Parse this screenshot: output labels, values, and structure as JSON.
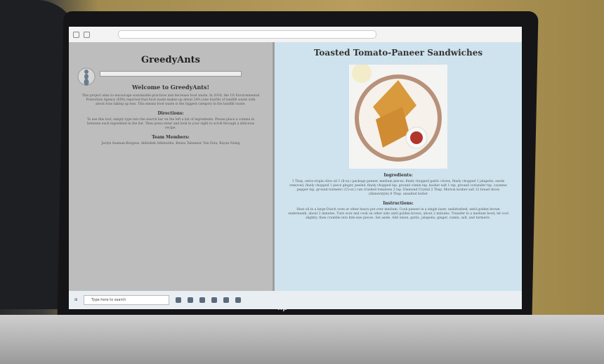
{
  "site": {
    "brand": "GreedyAnts",
    "welcome_heading": "Welcome to GreedyAnts!",
    "intro_text": "This project aims to encourage sustainable practices and decrease food waste. In 2018, the US Environmental Protection Agency (EPA) reported that food waste makes up about 24% (one fourth) of landfill waste with about tons taking up less. This means food waste is the biggest category in the landfill waste.",
    "directions_heading": "Directions:",
    "directions_text": "To use this tool, simply type into the search bar on the left a list of ingredients. Please place a comma in between each ingredient in the list. Then press enter and look to your right to scroll through a delicious recipe.",
    "team_heading": "Team Members:",
    "team_text": "Jaclyn Seaman-Burgess, Abhishek Athimuthu, Bensu Tabaneer, Yan Fatu, Rayan Naing"
  },
  "recipe": {
    "title": "Toasted Tomato-Paneer Sandwiches",
    "ingredients_heading": "Ingredients:",
    "ingredients_text": "1 Tbsp. extra-virgin olive oil 1 (8-oz.) package paneer, medium pieces, finely chopped garlic cloves, finely chopped 1 jalapeño, seeds removed, finely chopped 1 piece ginger, peeled, finely chopped tsp. ground cumin tsp. kosher salt 1 tsp. ground coriander tsp. cayenne pepper tsp. ground turmeric (15-oz.) can crushed tomatoes 2 tsp. Diamond Crystal 2 Tbsp. Morton kosher salt 12 bread slices (dinnerstyle) 6 Tbsp. unsalted butter",
    "instructions_heading": "Instructions:",
    "instructions_text": "Heat oil in a large Dutch oven or other heavy pot over medium. Cook paneer in a single layer, undisturbed, until golden brown underneath, about 2 minutes. Turn over and cook on other side until golden brown, about 2 minutes. Transfer to a medium bowl; let cool slightly, then crumble into bite-size pieces. Set aside. Add onion, garlic, jalapeño, ginger, cumin, salt, and turmeric."
  },
  "taskbar": {
    "search_placeholder": "Type here to search"
  }
}
